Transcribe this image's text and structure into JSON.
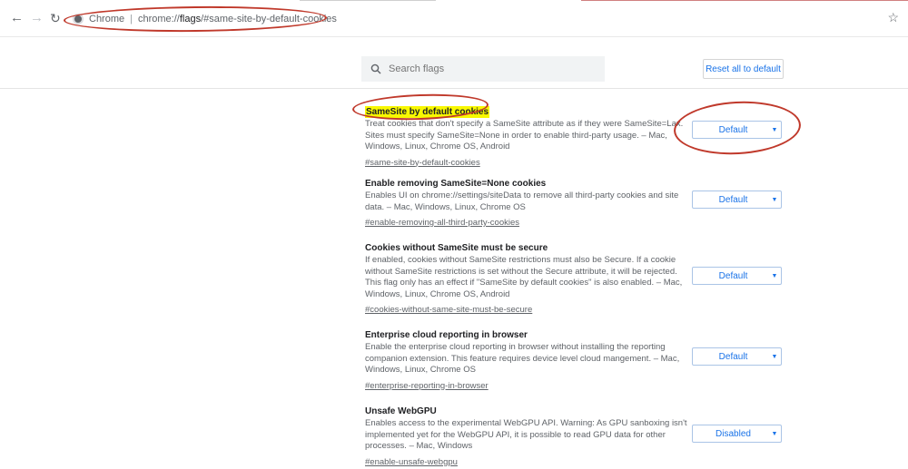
{
  "browser": {
    "back_icon": "arrow-left-icon",
    "forward_icon": "arrow-right-icon",
    "reload_icon": "reload-icon",
    "omnibox": {
      "site_label": "Chrome",
      "url_prefix": "chrome://",
      "url_bold": "flags",
      "url_suffix": "/#same-site-by-default-cookies"
    },
    "bookmark_icon": "star-icon"
  },
  "flags_header": {
    "search_placeholder": "Search flags",
    "reset_label": "Reset all to default"
  },
  "experiments": [
    {
      "title": "SameSite by default cookies",
      "description": "Treat cookies that don't specify a SameSite attribute as if they were SameSite=Lax. Sites must specify SameSite=None in order to enable third-party usage. – Mac, Windows, Linux, Chrome OS, Android",
      "link": "#same-site-by-default-cookies",
      "value": "Default",
      "highlighted": true
    },
    {
      "title": "Enable removing SameSite=None cookies",
      "description": "Enables UI on chrome://settings/siteData to remove all third-party cookies and site data. – Mac, Windows, Linux, Chrome OS",
      "link": "#enable-removing-all-third-party-cookies",
      "value": "Default"
    },
    {
      "title": "Cookies without SameSite must be secure",
      "description": "If enabled, cookies without SameSite restrictions must also be Secure. If a cookie without SameSite restrictions is set without the Secure attribute, it will be rejected. This flag only has an effect if \"SameSite by default cookies\" is also enabled. – Mac, Windows, Linux, Chrome OS, Android",
      "link": "#cookies-without-same-site-must-be-secure",
      "value": "Default"
    },
    {
      "title": "Enterprise cloud reporting in browser",
      "description": "Enable the enterprise cloud reporting in browser without installing the reporting companion extension. This feature requires device level cloud mangement. – Mac, Windows, Linux, Chrome OS",
      "link": "#enterprise-reporting-in-browser",
      "value": "Default"
    },
    {
      "title": "Unsafe WebGPU",
      "description": "Enables access to the experimental WebGPU API. Warning: As GPU sanboxing isn't implemented yet for the WebGPU API, it is possible to read GPU data for other processes. – Mac, Windows",
      "link": "#enable-unsafe-webgpu",
      "value": "Disabled"
    }
  ],
  "colors": {
    "highlight": "#f8f800",
    "annotation": "#c0392b",
    "accent": "#1a73e8"
  }
}
